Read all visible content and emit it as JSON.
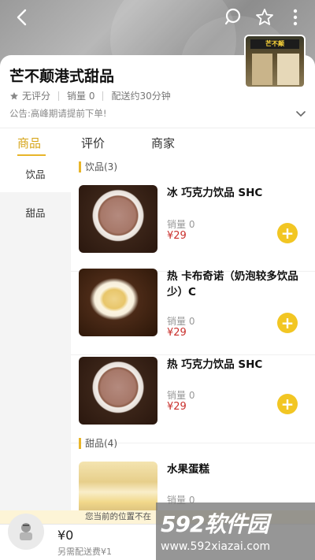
{
  "header": {
    "icons": [
      "back-icon",
      "search-icon",
      "star-icon",
      "more-icon"
    ]
  },
  "store": {
    "name": "芒不颠港式甜品",
    "rating": "无评分",
    "sales": "销量 0",
    "delivery": "配送约30分钟",
    "notice": "公告:高峰期请提前下单!",
    "logo_text": "芒不颠"
  },
  "tabs": [
    {
      "label": "商品",
      "active": true
    },
    {
      "label": "评价",
      "active": false
    },
    {
      "label": "商家",
      "active": false
    }
  ],
  "categories": [
    {
      "label": "饮品",
      "active": true
    },
    {
      "label": "甜品",
      "active": false
    }
  ],
  "sections": [
    {
      "title": "饮品(3)",
      "items": [
        {
          "name": "冰 巧克力饮品 SHC",
          "sold": "销量 0",
          "price": "¥29"
        },
        {
          "name": "热 卡布奇诺（奶泡较多饮品少）C",
          "sold": "销量 0",
          "price": "¥29"
        },
        {
          "name": "热 巧克力饮品 SHC",
          "sold": "销量 0",
          "price": "¥29"
        }
      ]
    },
    {
      "title": "甜品(4)",
      "items": [
        {
          "name": "水果蛋糕",
          "sold": "销量 0",
          "price": ""
        }
      ]
    }
  ],
  "location_notice": "您当前的位置不在",
  "cart": {
    "total": "¥0",
    "fee": "另需配送费¥1"
  },
  "watermark": {
    "logo_num": "592",
    "logo_text": "软件园",
    "url": "www.592xiazai.com"
  },
  "colors": {
    "accent": "#e8b52a",
    "add_button": "#f2c623",
    "price": "#c9302c"
  }
}
